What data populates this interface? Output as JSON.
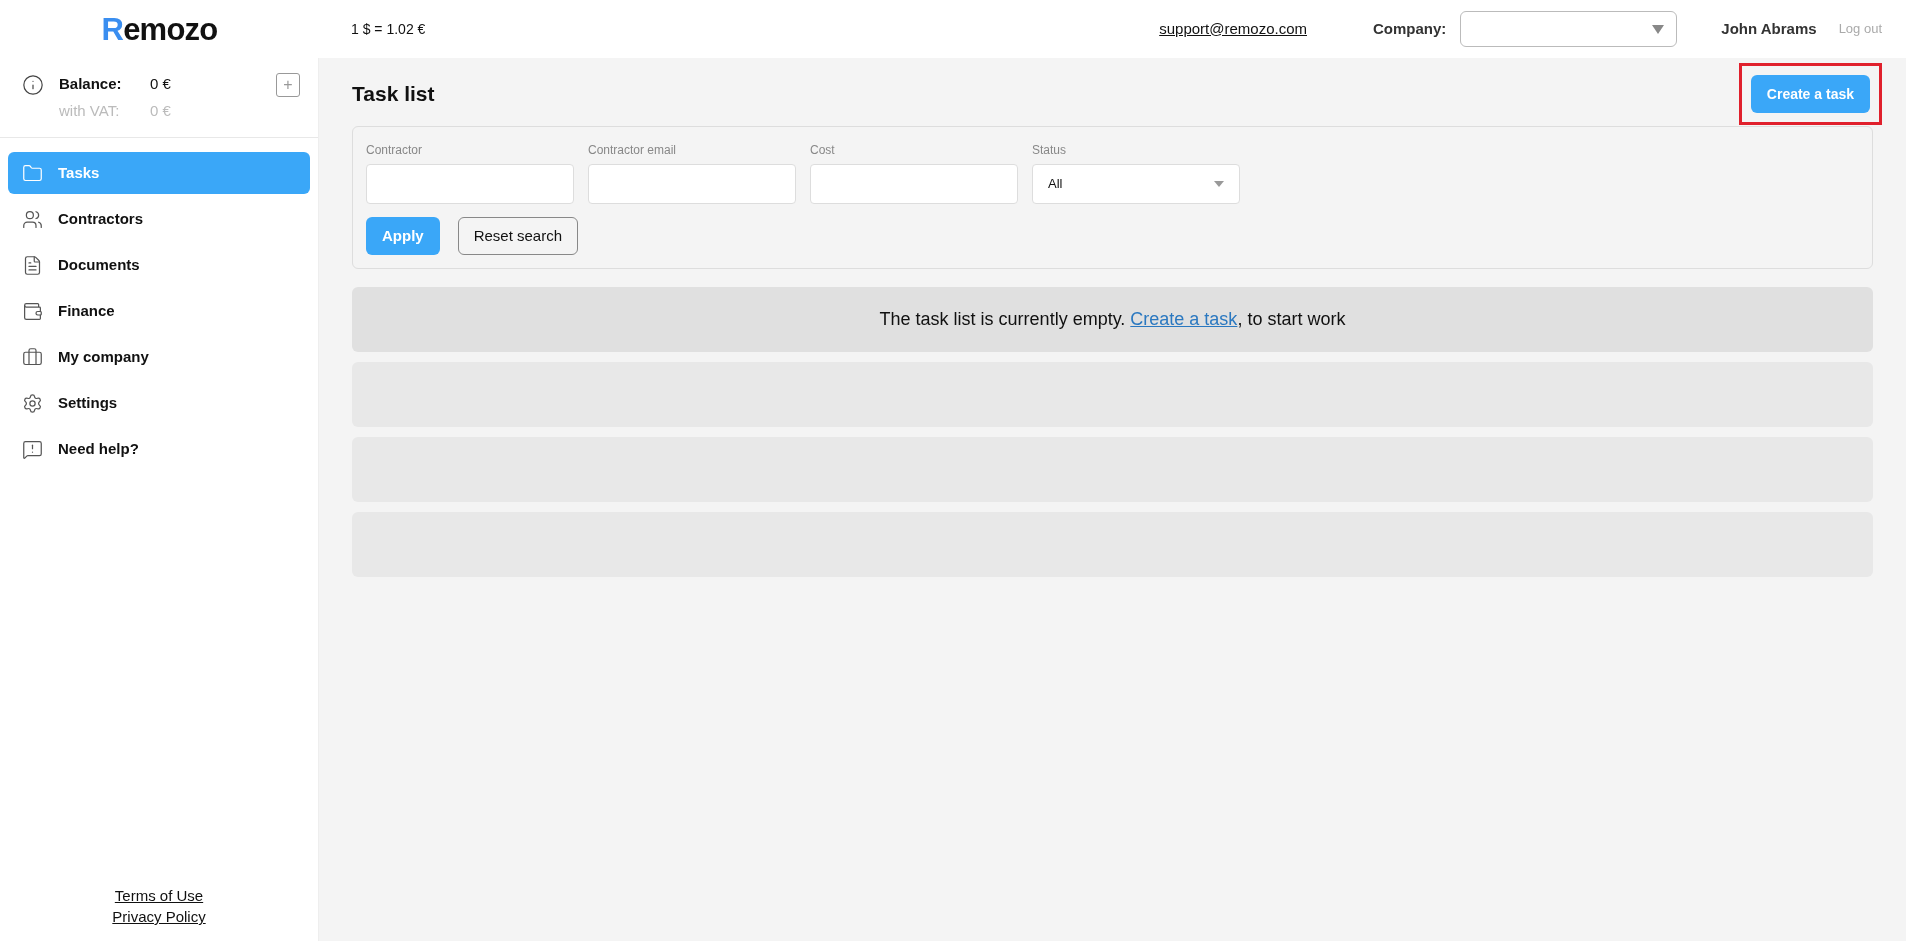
{
  "header": {
    "logo": {
      "first": "R",
      "rest": "emozo"
    },
    "rate": "1 $ = 1.02 €",
    "support_email": "support@remozo.com",
    "company_label": "Company:",
    "user_name": "John Abrams",
    "logout": "Log out"
  },
  "balance": {
    "label": "Balance:",
    "value": "0 €",
    "vat_label": "with VAT:",
    "vat_value": "0 €",
    "add": "+"
  },
  "sidebar": {
    "items": [
      {
        "label": "Tasks",
        "selected": true
      },
      {
        "label": "Contractors",
        "selected": false
      },
      {
        "label": "Documents",
        "selected": false
      },
      {
        "label": "Finance",
        "selected": false
      },
      {
        "label": "My company",
        "selected": false
      },
      {
        "label": "Settings",
        "selected": false
      },
      {
        "label": "Need help?",
        "selected": false
      }
    ],
    "footer_links": [
      "Terms of Use",
      "Privacy Policy"
    ]
  },
  "page": {
    "title": "Task list",
    "create_button": {
      "label": "Create a task",
      "highlighted": true
    }
  },
  "filters": {
    "fields": [
      {
        "label": "Contractor",
        "kind": "text"
      },
      {
        "label": "Contractor email",
        "kind": "text"
      },
      {
        "label": "Cost",
        "kind": "text"
      },
      {
        "label": "Status",
        "kind": "select",
        "value": "All"
      }
    ],
    "apply": "Apply",
    "reset": "Reset search"
  },
  "empty_message": {
    "before": "The task list is currently empty. ",
    "link": "Create a task",
    "after": ", to start work"
  }
}
